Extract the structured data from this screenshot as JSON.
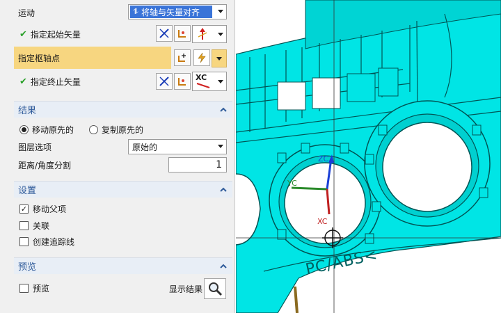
{
  "motion": {
    "label": "运动",
    "selected": "将轴与矢量对齐"
  },
  "start_vector": {
    "label": "指定起始矢量"
  },
  "pivot": {
    "label": "指定枢轴点"
  },
  "end_vector": {
    "label": "指定终止矢量",
    "xc_label": "XC"
  },
  "result": {
    "title": "结果",
    "option_move": "移动原先的",
    "option_copy": "复制原先的",
    "layer_label": "图层选项",
    "layer_value": "原始的",
    "distance_label": "距离/角度分割",
    "distance_value": "1"
  },
  "settings": {
    "title": "设置",
    "move_parent": "移动父项",
    "associate": "关联",
    "create_trace": "创建追踪线"
  },
  "preview": {
    "title": "预览",
    "preview_label": "预览",
    "show_result": "显示结果"
  },
  "viewport": {
    "axis_zc": "ZC",
    "axis_yc": "YC",
    "axis_xc": "XC",
    "part_text": "PC/ABS<",
    "model_color": "#00e5e5"
  }
}
